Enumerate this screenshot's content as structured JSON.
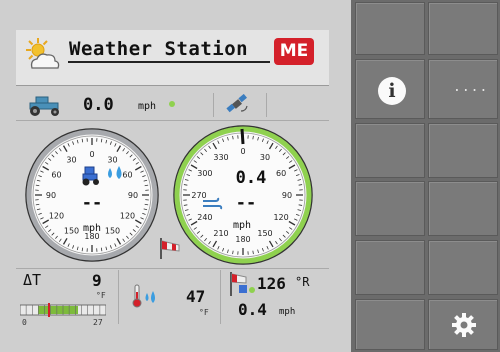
{
  "header": {
    "title": "Weather Station",
    "logo": "ME"
  },
  "speed_row": {
    "value": "0.0",
    "unit": "mph"
  },
  "gauge_left": {
    "ticks": [
      "0",
      "30",
      "60",
      "90",
      "120",
      "150",
      "180",
      "150",
      "120",
      "90",
      "60",
      "30"
    ],
    "value": "--",
    "unit": "mph"
  },
  "gauge_right": {
    "ticks": [
      "0",
      "30",
      "60",
      "90",
      "120",
      "150",
      "180",
      "210",
      "240",
      "270",
      "300",
      "330"
    ],
    "value": "0.4",
    "value2": "--",
    "unit": "mph"
  },
  "bottom": {
    "delta_t_label": "ΔT",
    "delta_t_value": "9",
    "delta_t_unit": "°F",
    "bar_min": "0",
    "bar_max": "27",
    "temp_value": "47",
    "temp_unit": "°F",
    "wind_dir_value": "126",
    "wind_dir_unit": "°R",
    "wind_speed_value": "0.4",
    "wind_speed_unit": "mph"
  },
  "sidebar": {
    "info_label": "i",
    "more_label": "...."
  },
  "colors": {
    "logo_red": "#d4202a",
    "gauge_green": "#8fd14f",
    "bar_green": "#7dbb3c"
  }
}
